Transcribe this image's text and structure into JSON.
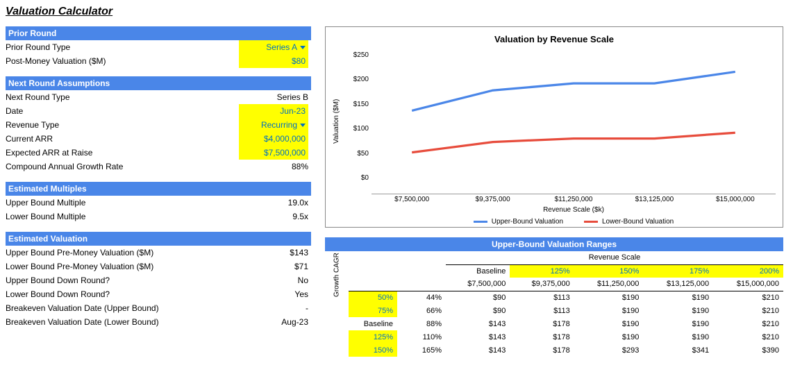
{
  "title": "Valuation Calculator",
  "sections": {
    "prior_round": {
      "header": "Prior Round",
      "type_label": "Prior Round Type",
      "type_value": "Series A",
      "post_money_label": "Post-Money Valuation ($M)",
      "post_money_value": "$80"
    },
    "next_round": {
      "header": "Next Round Assumptions",
      "type_label": "Next Round Type",
      "type_value": "Series B",
      "date_label": "Date",
      "date_value": "Jun-23",
      "rev_type_label": "Revenue Type",
      "rev_type_value": "Recurring",
      "current_arr_label": "Current ARR",
      "current_arr_value": "$4,000,000",
      "expected_arr_label": "Expected ARR at Raise",
      "expected_arr_value": "$7,500,000",
      "cagr_label": "Compound Annual Growth Rate",
      "cagr_value": "88%"
    },
    "multiples": {
      "header": "Estimated Multiples",
      "upper_label": "Upper Bound Multiple",
      "upper_value": "19.0x",
      "lower_label": "Lower Bound Multiple",
      "lower_value": "9.5x"
    },
    "valuation": {
      "header": "Estimated Valuation",
      "upper_pm_label": "Upper Bound Pre-Money Valuation ($M)",
      "upper_pm_value": "$143",
      "lower_pm_label": "Lower Bound Pre-Money Valuation ($M)",
      "lower_pm_value": "$71",
      "upper_down_label": "Upper Bound Down Round?",
      "upper_down_value": "No",
      "lower_down_label": "Lower Bound Down Round?",
      "lower_down_value": "Yes",
      "breakeven_upper_label": "Breakeven Valuation Date (Upper Bound)",
      "breakeven_upper_value": "-",
      "breakeven_lower_label": "Breakeven Valuation Date (Lower Bound)",
      "breakeven_lower_value": "Aug-23"
    }
  },
  "chart_data": {
    "type": "line",
    "title": "Valuation by Revenue Scale",
    "ylabel": "Valuation ($M)",
    "xlabel": "Revenue Scale ($k)",
    "ylim": [
      0,
      250
    ],
    "y_ticks": [
      "$250",
      "$200",
      "$150",
      "$100",
      "$50",
      "$0"
    ],
    "categories": [
      "$7,500,000",
      "$9,375,000",
      "$11,250,000",
      "$13,125,000",
      "$15,000,000"
    ],
    "series": [
      {
        "name": "Upper-Bound Valuation",
        "color": "#4a86e8",
        "values": [
          143,
          178,
          190,
          190,
          210
        ]
      },
      {
        "name": "Lower-Bound Valuation",
        "color": "#e74c3c",
        "values": [
          71,
          89,
          95,
          95,
          105
        ]
      }
    ]
  },
  "ranges": {
    "header": "Upper-Bound Valuation Ranges",
    "rev_scale_label": "Revenue Scale",
    "cagr_label": "Growth CAGR",
    "col_headers": [
      "Baseline",
      "125%",
      "150%",
      "175%",
      "200%"
    ],
    "col_values": [
      "$7,500,000",
      "$9,375,000",
      "$11,250,000",
      "$13,125,000",
      "$15,000,000"
    ],
    "rows": [
      {
        "scale_label": "50%",
        "cagr": "44%",
        "vals": [
          "$90",
          "$113",
          "$190",
          "$190",
          "$210"
        ]
      },
      {
        "scale_label": "75%",
        "cagr": "66%",
        "vals": [
          "$90",
          "$113",
          "$190",
          "$190",
          "$210"
        ]
      },
      {
        "scale_label": "Baseline",
        "cagr": "88%",
        "vals": [
          "$143",
          "$178",
          "$190",
          "$190",
          "$210"
        ]
      },
      {
        "scale_label": "125%",
        "cagr": "110%",
        "vals": [
          "$143",
          "$178",
          "$190",
          "$190",
          "$210"
        ]
      },
      {
        "scale_label": "150%",
        "cagr": "165%",
        "vals": [
          "$143",
          "$178",
          "$293",
          "$341",
          "$390"
        ]
      }
    ]
  }
}
